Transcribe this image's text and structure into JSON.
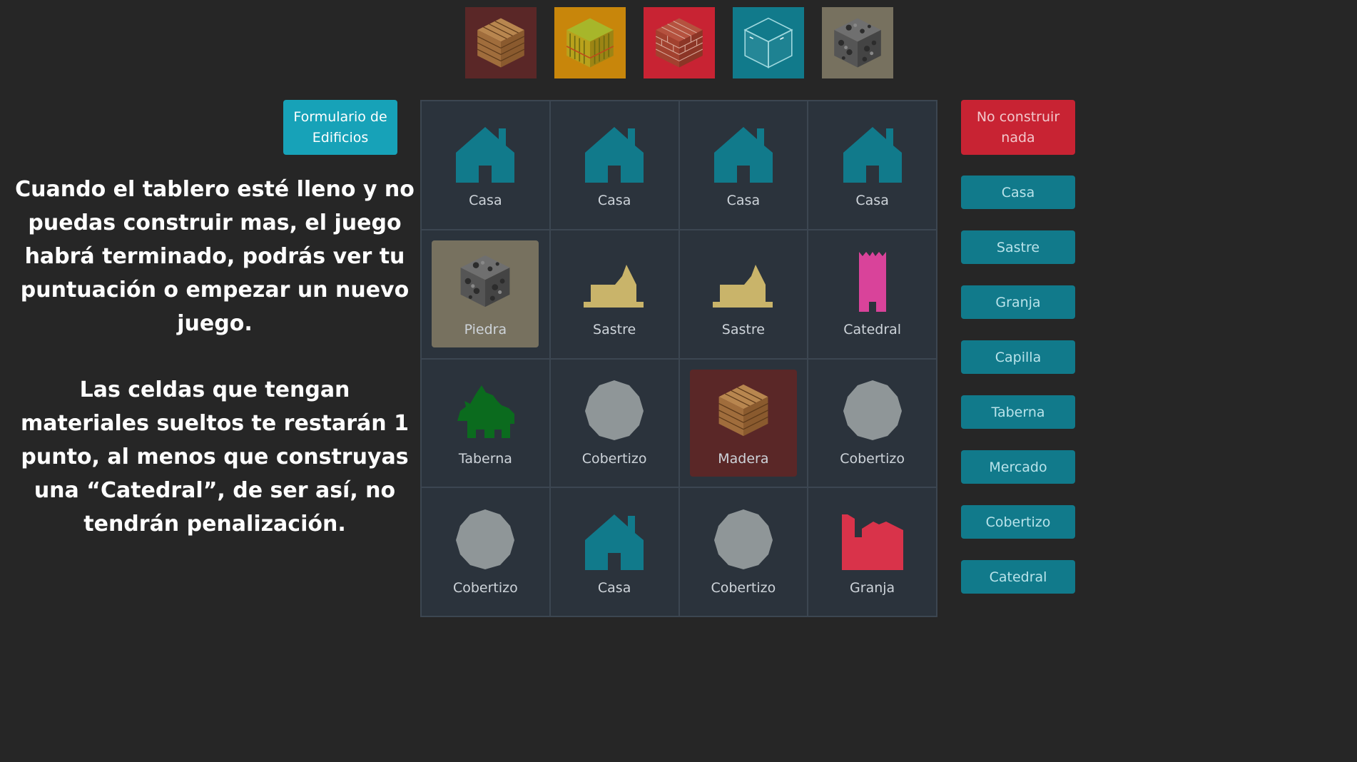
{
  "materials": [
    {
      "name": "madera",
      "icon": "wood-block-icon",
      "bg": "#5a2727"
    },
    {
      "name": "trigo",
      "icon": "wheat-block-icon",
      "bg": "#c8860b"
    },
    {
      "name": "ladrillo",
      "icon": "brick-block-icon",
      "bg": "#c82333"
    },
    {
      "name": "cristal",
      "icon": "glass-block-icon",
      "bg": "#117a8b"
    },
    {
      "name": "piedra",
      "icon": "stone-block-icon",
      "bg": "#77715f"
    }
  ],
  "left": {
    "form_button": "Formulario de Edificios",
    "instruction_1": "Cuando el tablero esté lleno y no puedas construir mas, el juego habrá terminado, podrás ver tu puntuación o empezar un nuevo juego.",
    "instruction_2": "Las celdas que tengan materiales sueltos te restarán 1 punto, al menos que construyas una “Catedral”, de ser así, no tendrán penalización."
  },
  "board": {
    "cells": [
      {
        "label": "Casa",
        "icon": "house-icon",
        "color": "#117a8b"
      },
      {
        "label": "Casa",
        "icon": "house-icon",
        "color": "#117a8b"
      },
      {
        "label": "Casa",
        "icon": "house-icon",
        "color": "#117a8b"
      },
      {
        "label": "Casa",
        "icon": "house-icon",
        "color": "#117a8b"
      },
      {
        "label": "Piedra",
        "icon": "stone-block-icon",
        "bg": "#77715f"
      },
      {
        "label": "Sastre",
        "icon": "tailor-icon",
        "color": "#c9b46a"
      },
      {
        "label": "Sastre",
        "icon": "tailor-icon",
        "color": "#c9b46a"
      },
      {
        "label": "Catedral",
        "icon": "cathedral-icon",
        "color": "#d9439a"
      },
      {
        "label": "Taberna",
        "icon": "tavern-icon",
        "color": "#0b6b1e"
      },
      {
        "label": "Cobertizo",
        "icon": "shed-icon",
        "color": "#8f9698"
      },
      {
        "label": "Madera",
        "icon": "wood-block-icon",
        "bg": "#5a2727"
      },
      {
        "label": "Cobertizo",
        "icon": "shed-icon",
        "color": "#8f9698"
      },
      {
        "label": "Cobertizo",
        "icon": "shed-icon",
        "color": "#8f9698"
      },
      {
        "label": "Casa",
        "icon": "house-icon",
        "color": "#117a8b"
      },
      {
        "label": "Cobertizo",
        "icon": "shed-icon",
        "color": "#8f9698"
      },
      {
        "label": "Granja",
        "icon": "farm-icon",
        "color": "#d9334a"
      }
    ]
  },
  "build": {
    "no_build": "No construir nada",
    "buttons": [
      "Casa",
      "Sastre",
      "Granja",
      "Capilla",
      "Taberna",
      "Mercado",
      "Cobertizo",
      "Catedral"
    ]
  }
}
